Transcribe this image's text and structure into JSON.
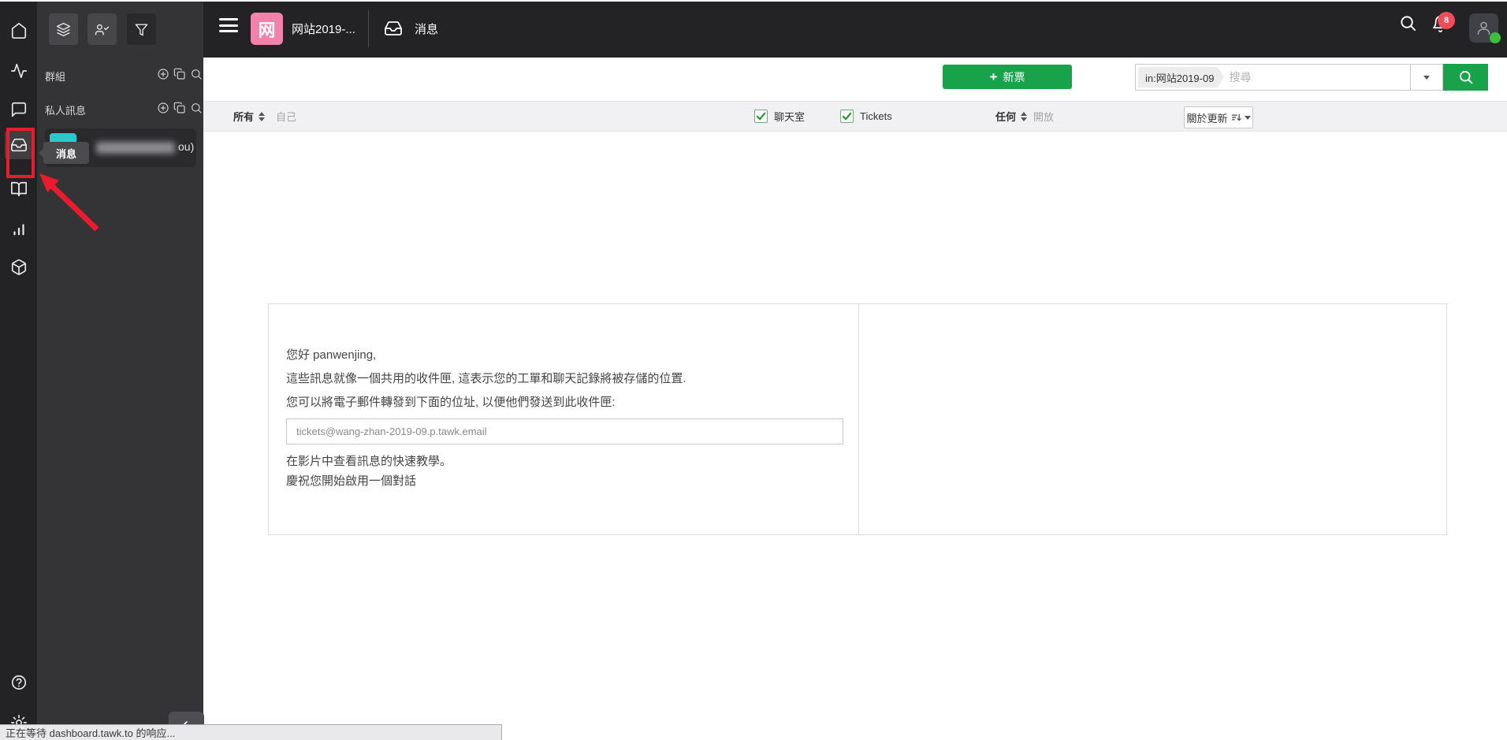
{
  "colors": {
    "accent_green": "#18a34b",
    "brand_pink": "#f082ab",
    "badge_red": "#f04c59",
    "annotation_red": "#ea1b2d",
    "avatar_teal": "#2bc7c9",
    "online_green": "#3ac03c"
  },
  "icons": {
    "nav": [
      "home-icon",
      "activity-icon",
      "chat-icon",
      "inbox-icon",
      "book-icon",
      "stats-icon",
      "addons-icon",
      "help-icon",
      "settings-icon"
    ],
    "sidebar": [
      "layers-icon",
      "user-check-icon",
      "filter-icon",
      "circle-plus-icon",
      "copy-icon",
      "search-icon",
      "collapse-arrow-icon"
    ],
    "topbar": [
      "hamburger-icon",
      "inbox-icon",
      "search-icon",
      "bell-icon",
      "user-icon"
    ],
    "misc": [
      "sort-arrows-icon",
      "sort-amount-icon",
      "caret-down-icon",
      "check-icon",
      "magnifier-icon"
    ]
  },
  "topbar": {
    "property_initial": "网",
    "property_name": "网站2019-...",
    "tab_messages": "消息",
    "notification_count": "8"
  },
  "sidebar": {
    "groups_label": "群組",
    "private_messages_label": "私人訊息",
    "inbox_tooltip": "消息",
    "conversation_name_suffix": "ou)"
  },
  "toolbar": {
    "new_ticket_plus": "+",
    "new_ticket_label": "新票",
    "search_tag": "in:网站2019-09",
    "search_placeholder": "搜尋"
  },
  "filter_bar": {
    "all": "所有",
    "self": "自己",
    "chat_room": "聊天室",
    "tickets": "Tickets",
    "any": "任何",
    "open": "開放",
    "sort_by_update": "關於更新"
  },
  "welcome": {
    "greeting": "您好 panwenjing,",
    "line_inbox": "這些訊息就像一個共用的收件匣, 這表示您的工單和聊天記錄將被存儲的位置.",
    "line_forward": "您可以將電子郵件轉發到下面的位址, 以便他們發送到此收件匣:",
    "forward_email": "tickets@wang-zhan-2019-09.p.tawk.email",
    "line_video": "在影片中查看訊息的快速教學。",
    "line_celebrate": "慶祝您開始啟用一個對話"
  },
  "status_bar": {
    "text": "正在等待 dashboard.tawk.to 的响应..."
  }
}
